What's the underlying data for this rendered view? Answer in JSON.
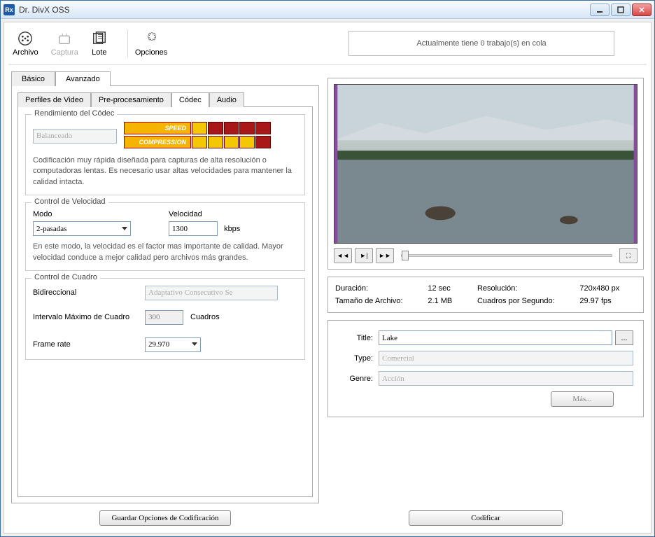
{
  "window": {
    "title": "Dr. DivX OSS"
  },
  "toolbar": {
    "archivo": "Archivo",
    "captura": "Captura",
    "lote": "Lote",
    "opciones": "Opciones",
    "queue_status": "Actualmente tiene 0 trabajo(s) en cola"
  },
  "outer_tabs": {
    "basico": "Básico",
    "avanzado": "Avanzado"
  },
  "inner_tabs": {
    "perfiles": "Perfiles de Video",
    "preproc": "Pre-procesamiento",
    "codec": "Códec",
    "audio": "Audio"
  },
  "codec_perf": {
    "title": "Rendimiento del Códec",
    "preset": "Balanceado",
    "speed_label": "SPEED",
    "compression_label": "COMPRESSION",
    "desc": "Codificación muy rápida diseñada para capturas de alta resolución o computadoras lentas. Es necesario usar altas velocidades para mantener la calidad intacta."
  },
  "rate_control": {
    "title": "Control de Velocidad",
    "modo_label": "Modo",
    "modo_value": "2-pasadas",
    "velocidad_label": "Velocidad",
    "velocidad_value": "1300",
    "velocidad_unit": "kbps",
    "desc": "En este modo, la velocidad es el factor mas importante de calidad. Mayor velocidad conduce a mejor calidad pero archivos más grandes."
  },
  "frame_control": {
    "title": "Control de Cuadro",
    "bidi_label": "Bidireccional",
    "bidi_value": "Adaptativo Consecutivo Se",
    "max_interval_label": "Intervalo Máximo de Cuadro",
    "max_interval_value": "300",
    "max_interval_unit": "Cuadros",
    "framerate_label": "Frame rate",
    "framerate_value": "29.970"
  },
  "info": {
    "duracion_label": "Duración:",
    "duracion_value": "12 sec",
    "resolucion_label": "Resolución:",
    "resolucion_value": "720x480 px",
    "tamano_label": "Tamaño de Archivo:",
    "tamano_value": "2.1 MB",
    "fps_label": "Cuadros por Segundo:",
    "fps_value": "29.97 fps"
  },
  "meta": {
    "title_label": "Title:",
    "title_value": "Lake",
    "type_label": "Type:",
    "type_value": "Comercial",
    "genre_label": "Genre:",
    "genre_value": "Acción",
    "more_button": "Más..."
  },
  "buttons": {
    "guardar": "Guardar Opciones de Codificación",
    "codificar": "Codificar"
  },
  "browse_glyph": "..."
}
